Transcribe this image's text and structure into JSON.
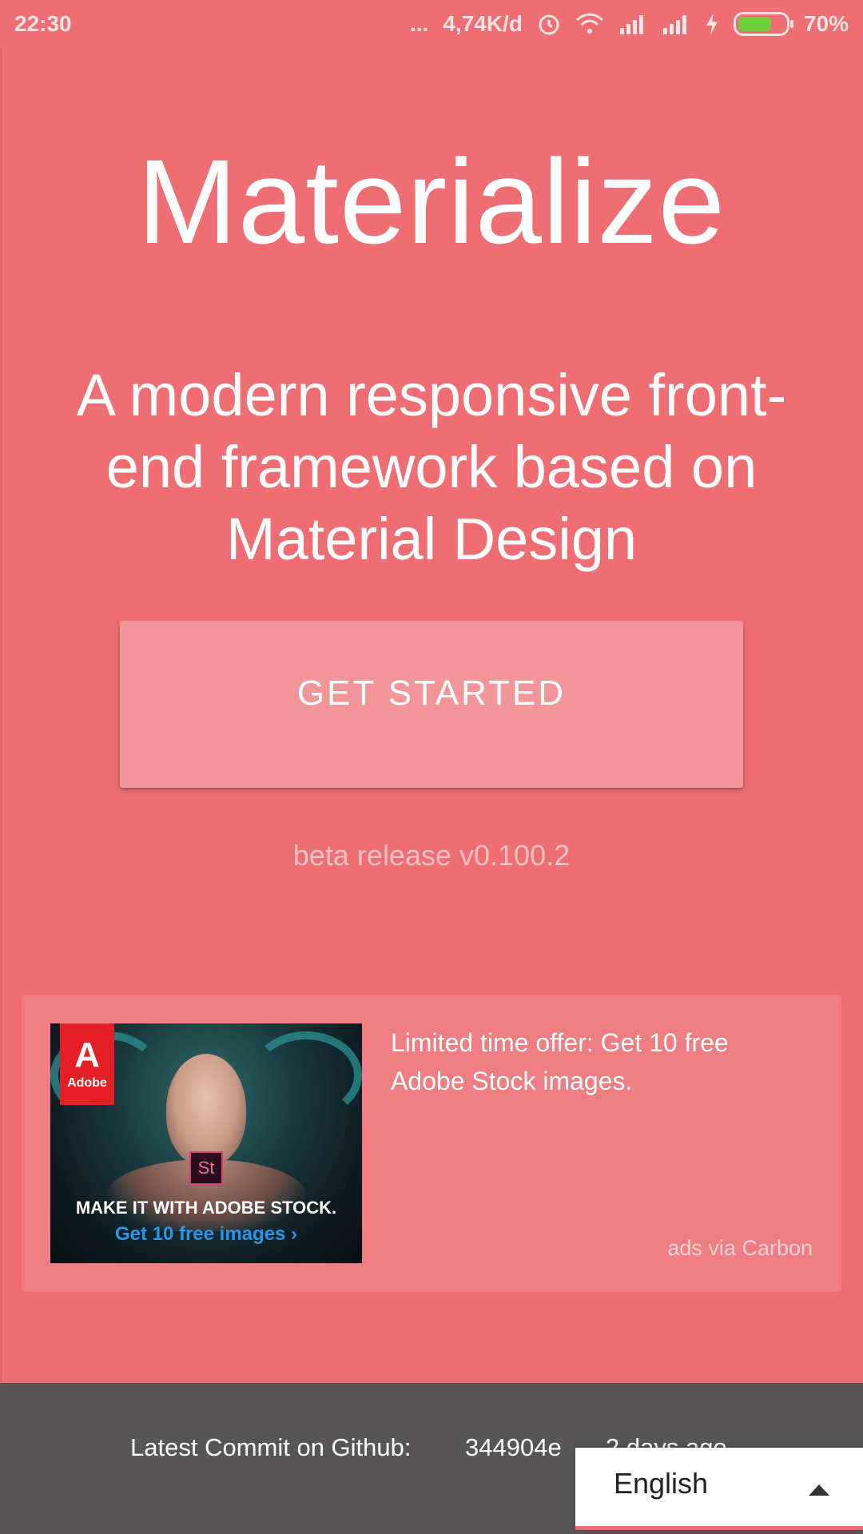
{
  "status_bar": {
    "time": "22:30",
    "dots": "...",
    "speed": "4,74K/d",
    "battery": "70%",
    "battery_level": 0.7,
    "icons": [
      "alarm-icon",
      "wifi-icon",
      "signal-icon",
      "signal-icon",
      "charging-icon",
      "battery-icon"
    ]
  },
  "hero": {
    "title": "Materialize",
    "subtitle": "A modern responsive front-end framework based on Material Design",
    "cta_label": "GET STARTED",
    "release": "beta release v0.100.2"
  },
  "ad": {
    "image_brand": "Adobe",
    "image_badge": "St",
    "image_headline": "MAKE IT WITH ADOBE STOCK.",
    "image_link": "Get 10 free images ›",
    "text": "Limited time offer: Get 10 free Adobe Stock images.",
    "via": "ads via Carbon"
  },
  "footer": {
    "commit_label": "Latest Commit on Github:",
    "commit_hash": "344904e",
    "commit_ago": "2 days ago"
  },
  "language": {
    "selected": "English"
  },
  "colors": {
    "background": "#ee6e73",
    "button": "#f29699",
    "footer": "#575555"
  }
}
